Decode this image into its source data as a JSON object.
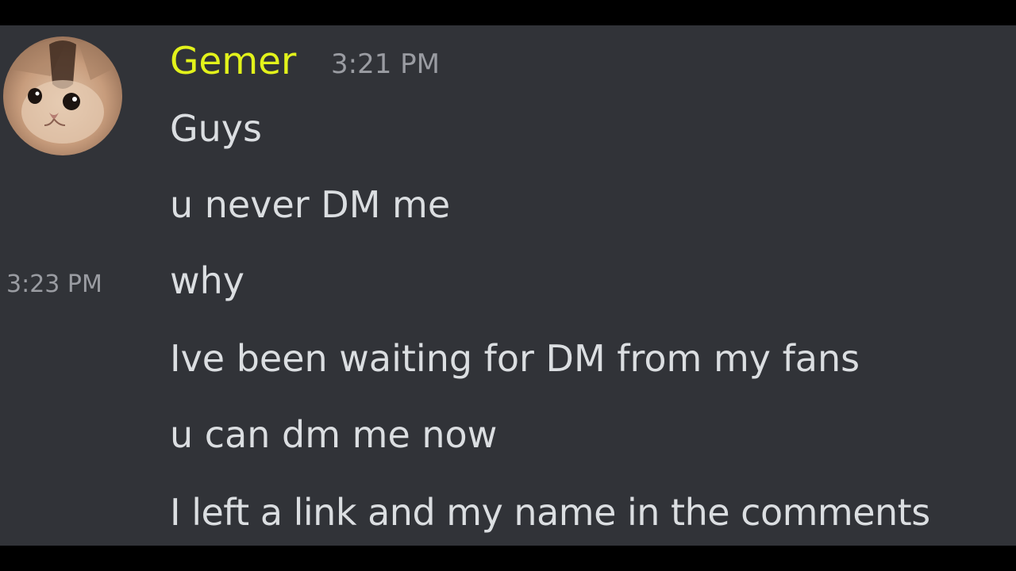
{
  "message_group": {
    "username": "Gemer",
    "username_color": "#e2f21b",
    "timestamp": "3:21 PM",
    "avatar_icon": "kitten-avatar",
    "messages": [
      {
        "text": "Guys",
        "hover_time": ""
      },
      {
        "text": "u never DM me",
        "hover_time": ""
      },
      {
        "text": "why",
        "hover_time": "3:23 PM"
      },
      {
        "text": "Ive been waiting for DM from my fans",
        "hover_time": ""
      },
      {
        "text": "u can dm me now",
        "hover_time": ""
      },
      {
        "text": "I left a link and my name in the comments",
        "hover_time": ""
      }
    ]
  }
}
